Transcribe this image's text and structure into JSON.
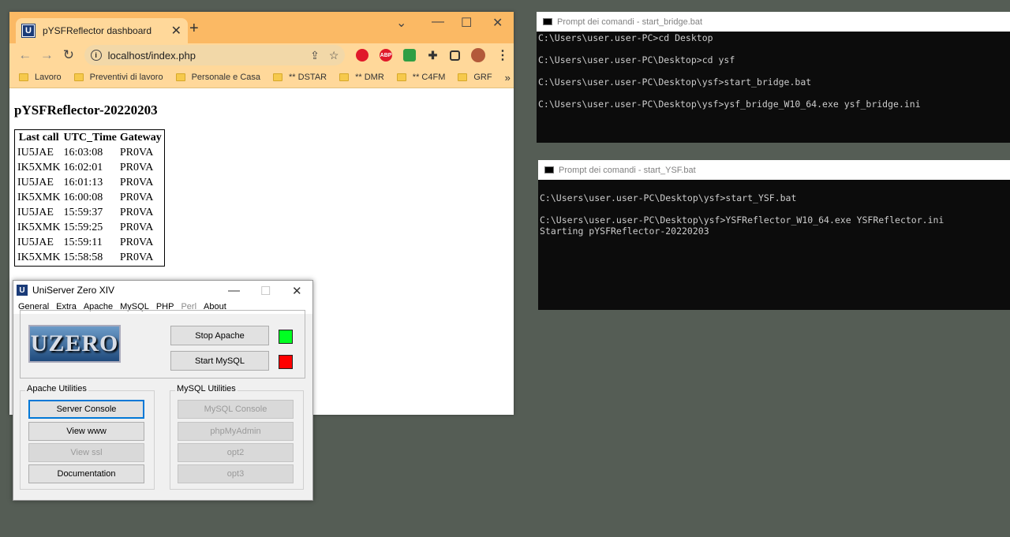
{
  "browser": {
    "tab_title": "pYSFReflector dashboard",
    "url": "localhost/index.php",
    "bookmarks": [
      "Lavoro",
      "Preventivi di lavoro",
      "Personale e Casa",
      "** DSTAR",
      "** DMR",
      "** C4FM",
      "GRF"
    ],
    "bookmarks_more": "»"
  },
  "page": {
    "heading": "pYSFReflector-20220203",
    "columns": [
      "Last call",
      "UTC_Time",
      "Gateway"
    ],
    "rows": [
      [
        "IU5JAE",
        "16:03:08",
        "PR0VA"
      ],
      [
        "IK5XMK",
        "16:02:01",
        "PR0VA"
      ],
      [
        "IU5JAE",
        "16:01:13",
        "PR0VA"
      ],
      [
        "IK5XMK",
        "16:00:08",
        "PR0VA"
      ],
      [
        "IU5JAE",
        "15:59:37",
        "PR0VA"
      ],
      [
        "IK5XMK",
        "15:59:25",
        "PR0VA"
      ],
      [
        "IU5JAE",
        "15:59:11",
        "PR0VA"
      ],
      [
        "IK5XMK",
        "15:58:58",
        "PR0VA"
      ]
    ]
  },
  "uniserver": {
    "title": "UniServer Zero XIV",
    "menu": [
      "General",
      "Extra",
      "Apache",
      "MySQL",
      "PHP",
      "Perl",
      "About"
    ],
    "logo_text": "UZERO",
    "stop_apache": "Stop Apache",
    "start_mysql": "Start MySQL",
    "apache_status_color": "#00ff22",
    "mysql_status_color": "#ff0000",
    "apache_utilities": {
      "label": "Apache Utilities",
      "buttons": [
        "Server Console",
        "View www",
        "View ssl",
        "Documentation"
      ]
    },
    "mysql_utilities": {
      "label": "MySQL Utilities",
      "buttons": [
        "MySQL Console",
        "phpMyAdmin",
        "opt2",
        "opt3"
      ]
    }
  },
  "console_bridge": {
    "title": "Prompt dei comandi - start_bridge.bat",
    "lines": [
      "C:\\Users\\user.user-PC>cd Desktop",
      "",
      "C:\\Users\\user.user-PC\\Desktop>cd ysf",
      "",
      "C:\\Users\\user.user-PC\\Desktop\\ysf>start_bridge.bat",
      "",
      "C:\\Users\\user.user-PC\\Desktop\\ysf>ysf_bridge_W10_64.exe ysf_bridge.ini"
    ]
  },
  "console_ysf": {
    "title": "Prompt dei comandi - start_YSF.bat",
    "lines": [
      "",
      "C:\\Users\\user.user-PC\\Desktop\\ysf>start_YSF.bat",
      "",
      "C:\\Users\\user.user-PC\\Desktop\\ysf>YSFReflector_W10_64.exe YSFReflector.ini",
      "Starting pYSFReflector-20220203"
    ]
  },
  "icons": {
    "browser_favicon": "U",
    "close": "✕",
    "new_tab": "+",
    "minimize": "—",
    "maximize": "☐",
    "chevron_down": "⌄",
    "back": "←",
    "forward": "→",
    "reload": "↻",
    "info": "i",
    "share": "⇪",
    "star": "☆",
    "menu": "⋮",
    "extensions": "✚"
  }
}
